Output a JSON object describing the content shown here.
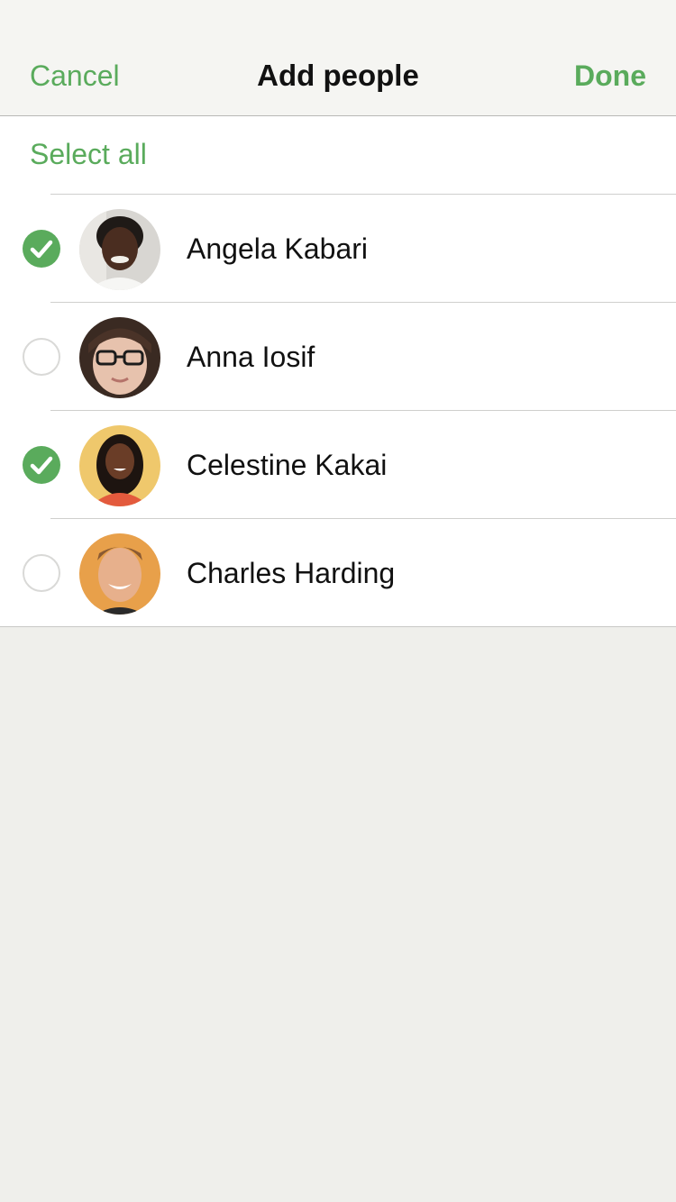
{
  "navbar": {
    "cancel_label": "Cancel",
    "title": "Add people",
    "done_label": "Done"
  },
  "list": {
    "select_all_label": "Select all",
    "people": [
      {
        "name": "Angela Kabari",
        "selected": true,
        "avatar": "person-photo"
      },
      {
        "name": "Anna Iosif",
        "selected": false,
        "avatar": "person-photo"
      },
      {
        "name": "Celestine Kakai",
        "selected": true,
        "avatar": "person-photo"
      },
      {
        "name": "Charles Harding",
        "selected": false,
        "avatar": "person-photo"
      }
    ]
  },
  "colors": {
    "accent": "#5aab5c",
    "navbar_bg": "#f5f5f2",
    "page_bg": "#efefeb",
    "text": "#111111"
  }
}
